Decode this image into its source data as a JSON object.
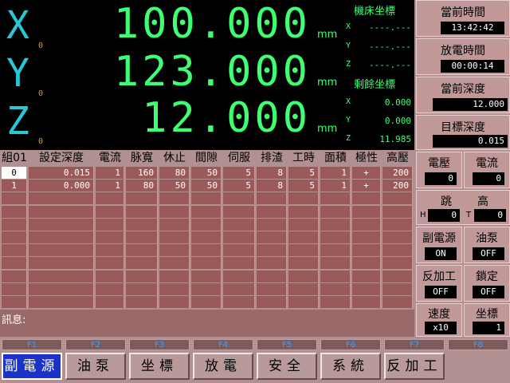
{
  "dro": {
    "axes": [
      {
        "label": "X",
        "sub": "0",
        "value": "100.000",
        "unit": "mm"
      },
      {
        "label": "Y",
        "sub": "0",
        "value": "123.000",
        "unit": "mm"
      },
      {
        "label": "Z",
        "sub": "0",
        "value": "12.000",
        "unit": "mm"
      }
    ]
  },
  "machine_coords": {
    "title": "機床坐標",
    "rows": [
      {
        "axis": "X",
        "value": "----.---"
      },
      {
        "axis": "Y",
        "value": "----.---"
      },
      {
        "axis": "Z",
        "value": "----.---"
      }
    ]
  },
  "remaining_coords": {
    "title": "剩餘坐標",
    "rows": [
      {
        "axis": "X",
        "value": "0.000"
      },
      {
        "axis": "Y",
        "value": "0.000"
      },
      {
        "axis": "Z",
        "value": "11.985"
      }
    ]
  },
  "right_panel": {
    "current_time": {
      "label": "當前時間",
      "value": "13:42:42"
    },
    "discharge_time": {
      "label": "放電時間",
      "value": "00:00:14"
    },
    "current_depth": {
      "label": "當前深度",
      "value": "12.000"
    },
    "target_depth": {
      "label": "目標深度",
      "value": "0.015"
    },
    "voltage": {
      "label": "電壓",
      "value": "0"
    },
    "current": {
      "label": "電流",
      "value": "0"
    },
    "jump": {
      "label_left": "跳",
      "label_right": "高",
      "h_label": "H",
      "h_value": "0",
      "t_label": "T",
      "t_value": "0"
    },
    "aux_power": {
      "label": "副電源",
      "value": "ON"
    },
    "oil_pump": {
      "label": "油泵",
      "value": "OFF"
    },
    "reverse": {
      "label": "反加工",
      "value": "OFF"
    },
    "lock": {
      "label": "鎖定",
      "value": "OFF"
    },
    "speed": {
      "label": "速度",
      "value": "x10"
    },
    "coord": {
      "label": "坐標",
      "value": "1"
    }
  },
  "table": {
    "headers": [
      "組01",
      "設定深度",
      "電流",
      "脉寬",
      "休止",
      "間隙",
      "伺服",
      "排渣",
      "工時",
      "面積",
      "極性",
      "高壓"
    ],
    "rows": [
      [
        "0",
        "0.015",
        "1",
        "160",
        "80",
        "50",
        "5",
        "8",
        "5",
        "1",
        "+",
        "200"
      ],
      [
        "1",
        "0.000",
        "1",
        "80",
        "50",
        "50",
        "5",
        "8",
        "5",
        "1",
        "+",
        "200"
      ]
    ]
  },
  "message": {
    "label": "訊息:"
  },
  "fkeys": [
    {
      "key": "F1",
      "label": "副電源",
      "active": true
    },
    {
      "key": "F2",
      "label": "油泵"
    },
    {
      "key": "F3",
      "label": "坐標"
    },
    {
      "key": "F4",
      "label": "放電"
    },
    {
      "key": "F5",
      "label": "安全"
    },
    {
      "key": "F6",
      "label": "系統"
    },
    {
      "key": "F7",
      "label": "反加工"
    },
    {
      "key": "F8",
      "label": ""
    }
  ]
}
